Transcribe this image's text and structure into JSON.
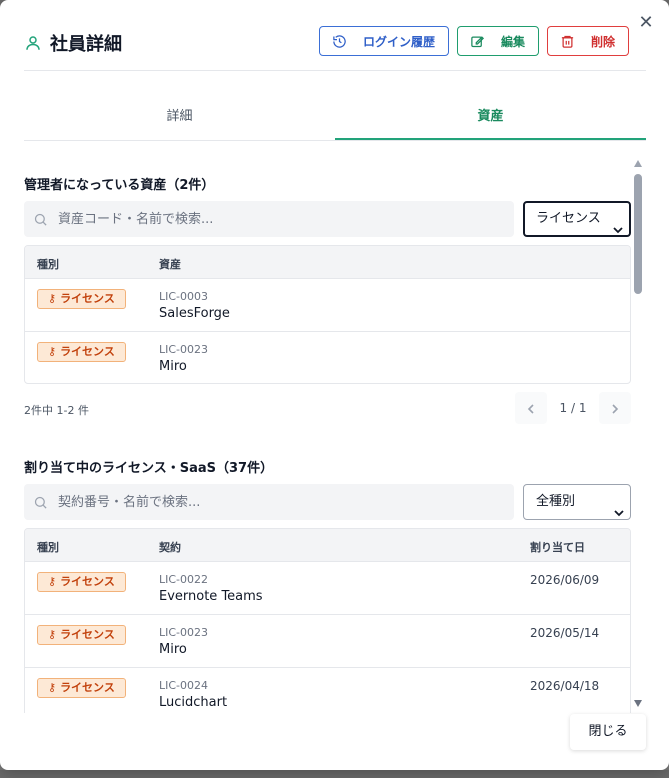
{
  "header": {
    "title": "社員詳細",
    "history_button": "ログイン履歴",
    "edit_button": "編集",
    "delete_button": "削除"
  },
  "tabs": [
    {
      "label": "詳細"
    },
    {
      "label": "資産",
      "active": true
    }
  ],
  "managed_assets": {
    "title": "管理者になっている資産（2件）",
    "search_placeholder": "資産コード・名前で検索...",
    "filter_selected": "ライセンス",
    "columns": [
      "種別",
      "資産"
    ],
    "rows": [
      {
        "type": "ライセンス",
        "code": "LIC-0003",
        "name": "SalesForge"
      },
      {
        "type": "ライセンス",
        "code": "LIC-0023",
        "name": "Miro"
      }
    ],
    "pager_info": "2件中 1-2 件",
    "page_label": "1 / 1"
  },
  "licenses": {
    "title": "割り当て中のライセンス・SaaS（37件）",
    "search_placeholder": "契約番号・名前で検索...",
    "filter_selected": "全種別",
    "columns": [
      "種別",
      "契約",
      "割り当て日"
    ],
    "rows": [
      {
        "type": "ライセンス",
        "code": "LIC-0022",
        "name": "Evernote Teams",
        "date": "2026/06/09"
      },
      {
        "type": "ライセンス",
        "code": "LIC-0023",
        "name": "Miro",
        "date": "2026/05/14"
      },
      {
        "type": "ライセンス",
        "code": "LIC-0024",
        "name": "Lucidchart",
        "date": "2026/04/18"
      }
    ]
  },
  "footer": {
    "close_button": "閉じる"
  },
  "colors": {
    "primary_green": "#22a37a",
    "history_blue": "#3b6fd6",
    "delete_red": "#e03e3e",
    "badge_orange": "#c2410c"
  }
}
